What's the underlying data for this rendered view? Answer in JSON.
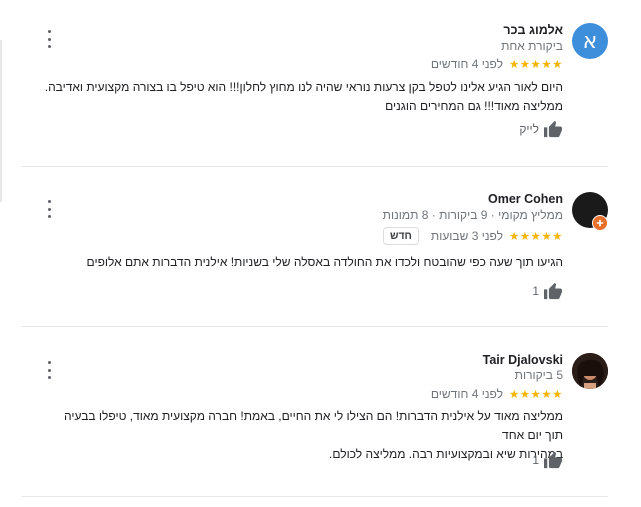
{
  "reviews": [
    {
      "avatar_letter": "א",
      "avatar_color": "#3d8edb",
      "name": "אלמוג בכר",
      "meta": "ביקורת אחת",
      "stars": "★★★★★",
      "time": "לפני 4 חודשים",
      "text_lines": [
        "היום לאור הגיע אלינו לטפל בקן צרעות נוראי שהיה לנו מחוץ לחלון!!! הוא טיפל בו בצורה מקצועית ואדיבה.",
        "ממליצה מאוד!!! גם המחירים הוגנים"
      ],
      "like_label": "לייק",
      "like_icon": "thumbs-up-icon"
    },
    {
      "avatar_color": "#1a1a1a",
      "badge_icon": "local-guide-icon",
      "badge_color": "#e8702a",
      "name": "Omer Cohen",
      "meta": "ממליץ מקומי · 9 ביקורות · 8 תמונות",
      "stars": "★★★★★",
      "time": "לפני 3 שבועות",
      "new_badge": "חדש",
      "text_lines": [
        "הגיעו תוך שעה כפי שהובטח ולכדו את החולדה באסלה שלי בשניות! אילנית הדברות אתם אלופים"
      ],
      "like_count": "1",
      "like_icon": "thumbs-up-icon"
    },
    {
      "avatar_color": "#b04a2a",
      "name": "Tair Djalovski",
      "meta": "5 ביקורות",
      "stars": "★★★★★",
      "time": "לפני 4 חודשים",
      "text_lines": [
        "ממליצה מאוד על אילנית הדברות! הם הצילו לי את החיים, באמת! חברה מקצועית מאוד, טיפלו בבעיה תוך יום אחד",
        "במהירות שיא ובמקצועיות רבה. ממליצה לכולם."
      ],
      "like_count": "1",
      "like_icon": "thumbs-up-icon"
    }
  ],
  "menu_icon": "more-vert-icon"
}
